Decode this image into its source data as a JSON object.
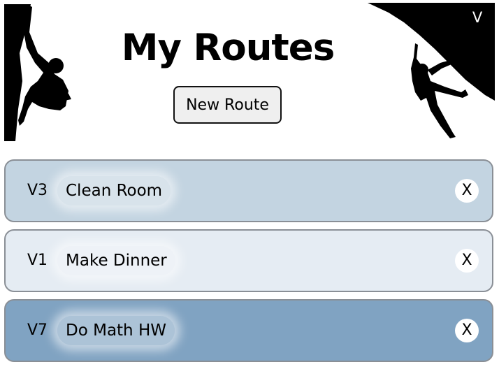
{
  "header": {
    "title": "My Routes",
    "new_route_label": "New Route",
    "corner_label": "V"
  },
  "routes": [
    {
      "grade": "V3",
      "name": "Clean Room",
      "color": "#c3d4e1",
      "delete_label": "X"
    },
    {
      "grade": "V1",
      "name": "Make Dinner",
      "color": "#e5ecf3",
      "delete_label": "X"
    },
    {
      "grade": "V7",
      "name": "Do Math HW",
      "color": "#80a3c2",
      "delete_label": "X"
    }
  ],
  "icons": {
    "left": "climber-silhouette-icon",
    "right": "climber-overhang-silhouette-icon"
  }
}
